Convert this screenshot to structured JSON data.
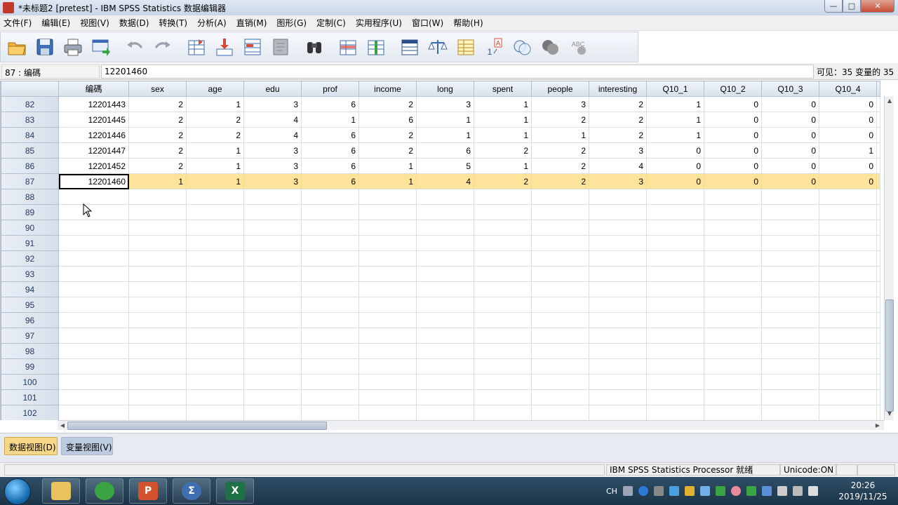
{
  "window": {
    "title": "*未标题2 [pretest] - IBM SPSS Statistics 数据编辑器",
    "controls": {
      "minimize": "—",
      "maximize": "□",
      "close": "✕"
    }
  },
  "menu": [
    "文件(F)",
    "编辑(E)",
    "视图(V)",
    "数据(D)",
    "转换(T)",
    "分析(A)",
    "直销(M)",
    "图形(G)",
    "定制(C)",
    "实用程序(U)",
    "窗口(W)",
    "帮助(H)"
  ],
  "toolbar": {
    "icons": [
      "open-folder-icon",
      "save-icon",
      "print-icon",
      "dialog-recall-icon",
      "undo-icon",
      "redo-icon",
      "goto-case-icon",
      "goto-variable-icon",
      "variables-icon",
      "run-descriptive-icon",
      "find-icon",
      "insert-cases-icon",
      "insert-variable-icon",
      "split-file-icon",
      "weight-cases-icon",
      "select-cases-icon",
      "value-labels-icon",
      "use-variable-sets-icon",
      "show-all-variables-icon",
      "spell-check-icon"
    ]
  },
  "cellbar": {
    "ref": "87 : 编碼",
    "value": "12201460",
    "visible": "可见：35 变量的 35"
  },
  "grid": {
    "columns": [
      "编碼",
      "sex",
      "age",
      "edu",
      "prof",
      "income",
      "long",
      "spent",
      "people",
      "interesting",
      "Q10_1",
      "Q10_2",
      "Q10_3",
      "Q10_4"
    ],
    "rows": [
      {
        "n": "82",
        "cells": [
          "12201443",
          "2",
          "1",
          "3",
          "6",
          "2",
          "3",
          "1",
          "3",
          "2",
          "1",
          "0",
          "0",
          "0"
        ]
      },
      {
        "n": "83",
        "cells": [
          "12201445",
          "2",
          "2",
          "4",
          "1",
          "6",
          "1",
          "1",
          "2",
          "2",
          "1",
          "0",
          "0",
          "0"
        ]
      },
      {
        "n": "84",
        "cells": [
          "12201446",
          "2",
          "2",
          "4",
          "6",
          "2",
          "1",
          "1",
          "1",
          "2",
          "1",
          "0",
          "0",
          "0"
        ]
      },
      {
        "n": "85",
        "cells": [
          "12201447",
          "2",
          "1",
          "3",
          "6",
          "2",
          "6",
          "2",
          "2",
          "3",
          "0",
          "0",
          "0",
          "1"
        ]
      },
      {
        "n": "86",
        "cells": [
          "12201452",
          "2",
          "1",
          "3",
          "6",
          "1",
          "5",
          "1",
          "2",
          "4",
          "0",
          "0",
          "0",
          "0"
        ]
      },
      {
        "n": "87",
        "cells": [
          "12201460",
          "1",
          "1",
          "3",
          "6",
          "1",
          "4",
          "2",
          "2",
          "3",
          "0",
          "0",
          "0",
          "0"
        ],
        "selected": true
      },
      {
        "n": "88",
        "cells": []
      },
      {
        "n": "89",
        "cells": []
      },
      {
        "n": "90",
        "cells": []
      },
      {
        "n": "91",
        "cells": []
      },
      {
        "n": "92",
        "cells": []
      },
      {
        "n": "93",
        "cells": []
      },
      {
        "n": "94",
        "cells": []
      },
      {
        "n": "95",
        "cells": []
      },
      {
        "n": "96",
        "cells": []
      },
      {
        "n": "97",
        "cells": []
      },
      {
        "n": "98",
        "cells": []
      },
      {
        "n": "99",
        "cells": []
      },
      {
        "n": "100",
        "cells": []
      },
      {
        "n": "101",
        "cells": []
      },
      {
        "n": "102",
        "cells": []
      }
    ]
  },
  "tabs": {
    "data_view": "数据视图(D)",
    "variable_view": "变量视图(V)"
  },
  "status": {
    "processor": "IBM SPSS Statistics Processor 就绪",
    "unicode": "Unicode:ON"
  },
  "taskbar": {
    "apps": [
      "explorer-icon",
      "refresh-app-icon",
      "powerpoint-icon",
      "spss-icon",
      "excel-icon"
    ],
    "lang": "CH",
    "time": "20:26",
    "date": "2019/11/25"
  },
  "colors": {
    "selected_row": "#fde49a",
    "data_tab": "#f7d88a",
    "variable_tab": "#bccbe0"
  }
}
